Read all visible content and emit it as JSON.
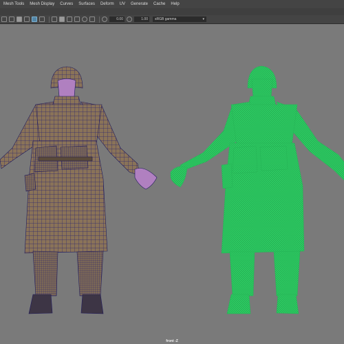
{
  "menubar": {
    "items": [
      "Mesh Tools",
      "Mesh Display",
      "Curves",
      "Surfaces",
      "Deform",
      "UV",
      "Generate",
      "Cache",
      "Help"
    ]
  },
  "toolbar": {
    "exposure_value": "0.00",
    "gamma_value": "1.00",
    "color_space": "sRGB gamma"
  },
  "viewport": {
    "camera_label": "front -Z",
    "background_color": "#7a7a7a"
  },
  "figures": [
    {
      "name": "wireframe-on-shaded soldier",
      "shade_color": "#8a7358",
      "wire_color": "#2a2370"
    },
    {
      "name": "green wireframe soldier",
      "wire_color": "#2ecc63"
    }
  ]
}
